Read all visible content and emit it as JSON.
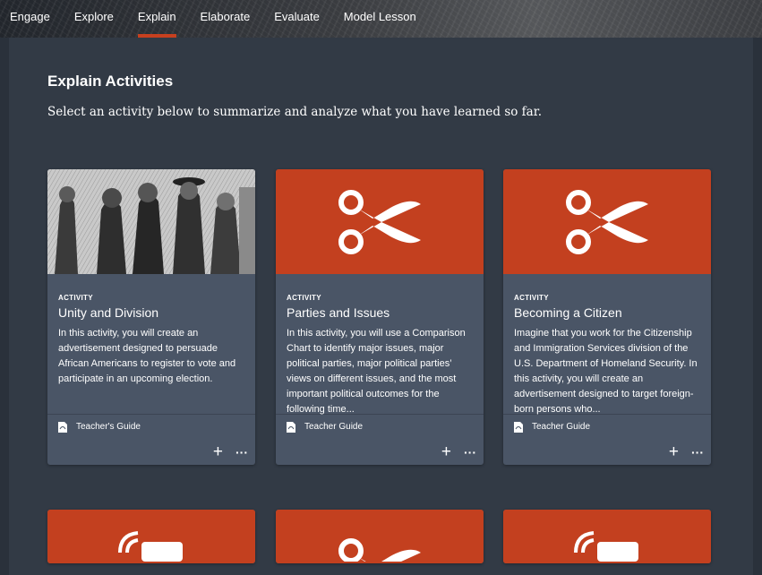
{
  "nav": {
    "tabs": [
      {
        "label": "Engage"
      },
      {
        "label": "Explore"
      },
      {
        "label": "Explain"
      },
      {
        "label": "Elaborate"
      },
      {
        "label": "Evaluate"
      },
      {
        "label": "Model Lesson"
      }
    ],
    "active_tab": "Explain",
    "accent_color": "#c7401f"
  },
  "page": {
    "heading": "Explain Activities",
    "subtitle": "Select an activity below to summarize and analyze what you have learned so far."
  },
  "cards": [
    {
      "eyebrow": "ACTIVITY",
      "title": "Unity and Division",
      "description": "In this activity, you will create an advertisement designed to persuade African Americans to register to vote and participate in an upcoming election.",
      "guide_label": "Teacher's Guide",
      "thumb": "historical-illustration",
      "thumb_color": "#bdbdbd"
    },
    {
      "eyebrow": "ACTIVITY",
      "title": "Parties and Issues",
      "description": "In this activity, you will use a Comparison Chart to identify major issues, major political parties, major political parties’ views on different issues, and the most important political outcomes for the following time...",
      "guide_label": "Teacher Guide",
      "thumb": "scissors-icon",
      "thumb_color": "#c3401f"
    },
    {
      "eyebrow": "ACTIVITY",
      "title": "Becoming a Citizen",
      "description": "Imagine that you work for the Citizenship and Immigration Services division of the U.S. Department of Homeland Security. In this activity, you will create an advertisement designed to target foreign-born persons who...",
      "guide_label": "Teacher Guide",
      "thumb": "scissors-icon",
      "thumb_color": "#c3401f"
    }
  ],
  "partial_cards": [
    {
      "thumb": "broadcast-icon"
    },
    {
      "thumb": "scissors-icon"
    },
    {
      "thumb": "broadcast-icon"
    }
  ],
  "actions": {
    "add": "+",
    "more": "···"
  }
}
